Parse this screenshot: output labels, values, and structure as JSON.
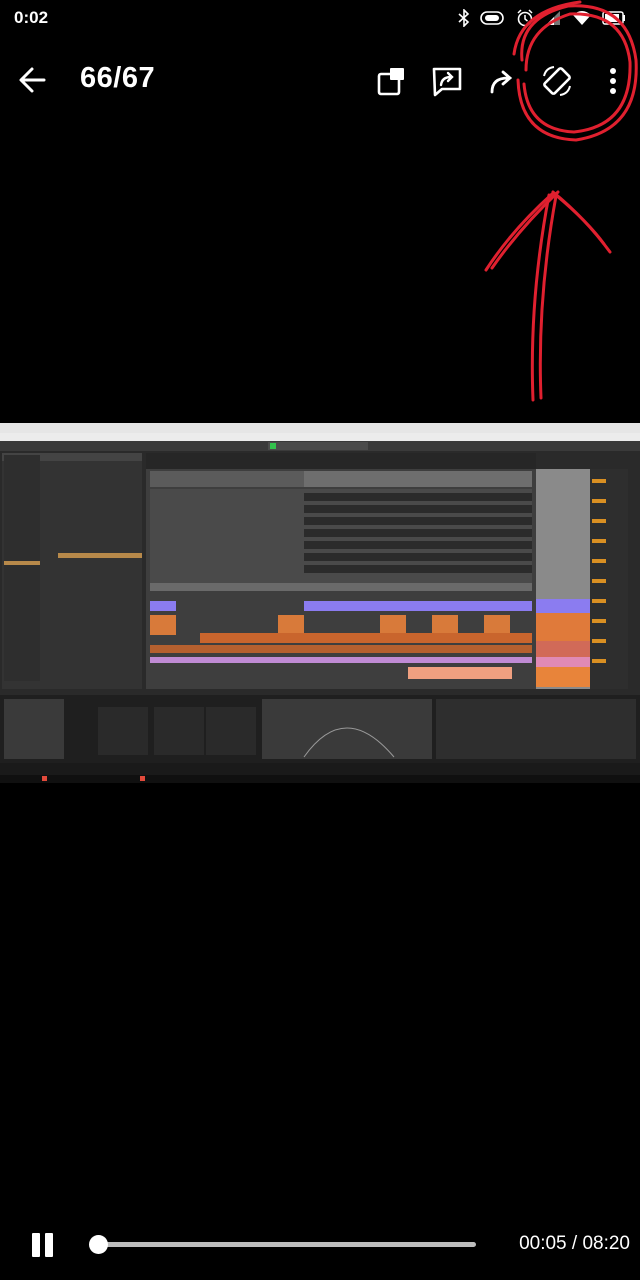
{
  "status_bar": {
    "time": "0:02"
  },
  "toolbar": {
    "counter": "66/67",
    "icons": [
      "back-arrow-icon",
      "add-to-album-icon",
      "share-icon",
      "forward-icon",
      "rotate-screen-icon",
      "more-vertical-icon"
    ]
  },
  "annotation_color": "#e0202f",
  "player": {
    "current_time": "00:05",
    "total_time": "08:20",
    "progress": 0.01
  }
}
